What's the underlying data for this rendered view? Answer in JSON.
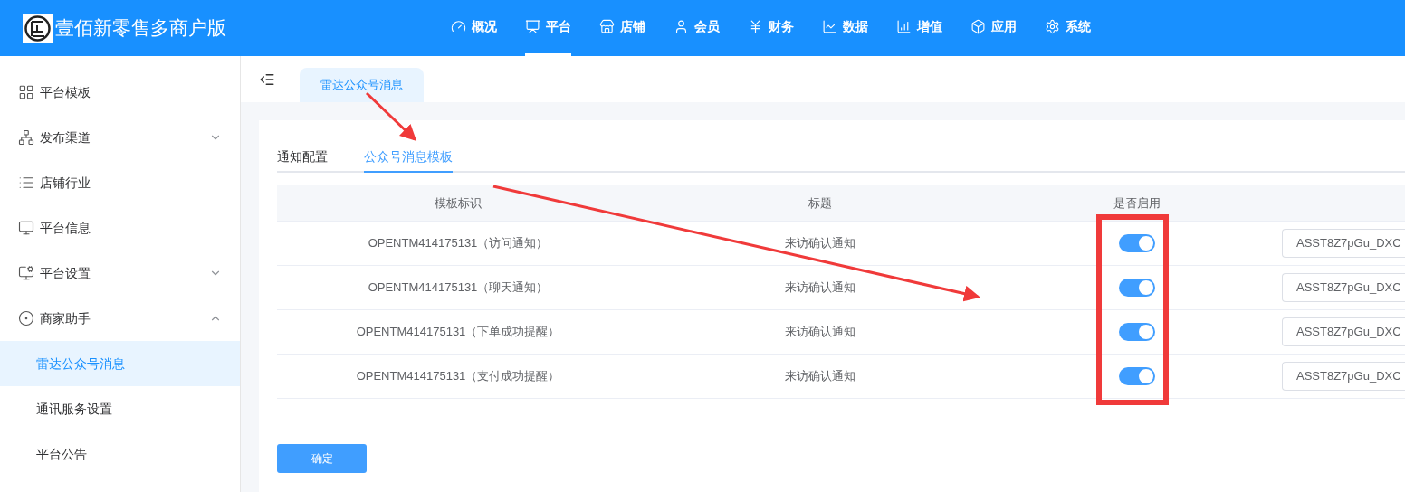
{
  "header": {
    "brand": "壹佰新零售多商户版",
    "nav": [
      {
        "label": "概况",
        "selected": false
      },
      {
        "label": "平台",
        "selected": true
      },
      {
        "label": "店铺",
        "selected": false
      },
      {
        "label": "会员",
        "selected": false
      },
      {
        "label": "财务",
        "selected": false
      },
      {
        "label": "数据",
        "selected": false
      },
      {
        "label": "增值",
        "selected": false
      },
      {
        "label": "应用",
        "selected": false
      },
      {
        "label": "系统",
        "selected": false
      }
    ]
  },
  "sidebar": {
    "items": [
      {
        "label": "平台模板",
        "selected": false
      },
      {
        "label": "发布渠道",
        "expanded": false,
        "selected": false
      },
      {
        "label": "店铺行业",
        "selected": false
      },
      {
        "label": "平台信息",
        "selected": false
      },
      {
        "label": "平台设置",
        "expanded": false,
        "selected": false
      },
      {
        "label": "商家助手",
        "expanded": true,
        "selected": false,
        "children": [
          {
            "label": "雷达公众号消息",
            "selected": true
          },
          {
            "label": "通讯服务设置",
            "selected": false
          },
          {
            "label": "平台公告",
            "selected": false
          }
        ]
      }
    ]
  },
  "page_tabs": [
    {
      "label": "雷达公众号消息",
      "selected": true
    }
  ],
  "sub_tabs": [
    {
      "label": "通知配置",
      "selected": false
    },
    {
      "label": "公众号消息模板",
      "selected": true
    }
  ],
  "table": {
    "columns": [
      "模板标识",
      "标题",
      "是否启用"
    ],
    "rows": [
      {
        "template": "OPENTM414175131（访问通知）",
        "title": "来访确认通知",
        "enabled": true,
        "column_4": "ASST8Z7pGu_DXC"
      },
      {
        "template": "OPENTM414175131（聊天通知）",
        "title": "来访确认通知",
        "enabled": true,
        "column_4": "ASST8Z7pGu_DXC"
      },
      {
        "template": "OPENTM414175131（下单成功提醒）",
        "title": "来访确认通知",
        "enabled": true,
        "column_4": "ASST8Z7pGu_DXC"
      },
      {
        "template": "OPENTM414175131（支付成功提醒）",
        "title": "来访确认通知",
        "enabled": true,
        "column_4": "ASST8Z7pGu_DXC"
      }
    ]
  },
  "confirm_button": "确定"
}
